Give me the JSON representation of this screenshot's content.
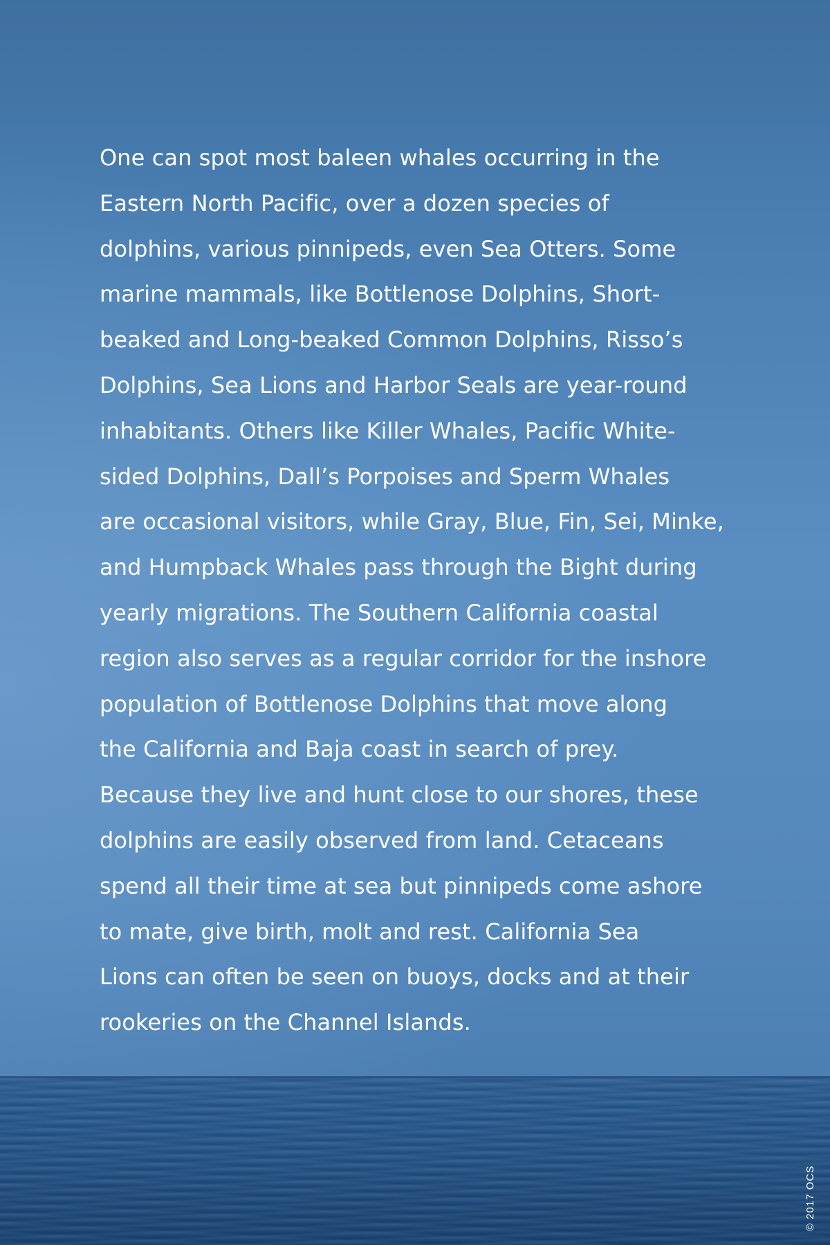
{
  "paragraph": {
    "lines": [
      "One can spot most baleen whales occurring in the",
      "Eastern North Pacific, over a dozen species of",
      "dolphins, various pinnipeds, even Sea Otters. Some",
      "marine mammals, like Bottlenose Dolphins, Short-",
      "beaked and Long-beaked Common Dolphins, Risso’s",
      "Dolphins, Sea Lions and Harbor Seals are year-round",
      "inhabitants. Others like Killer Whales, Pacific White-",
      "sided Dolphins, Dall’s Porpoises and Sperm Whales",
      "are occasional visitors, while Gray, Blue, Fin, Sei, Minke,",
      "and Humpback Whales pass through the Bight during",
      "yearly migrations. The Southern California coastal",
      "region also serves as a regular corridor for the inshore",
      "population of Bottlenose Dolphins that move along",
      "the California and Baja coast in search of prey.",
      "Because they live and hunt close to our shores, these",
      "dolphins are easily observed from land. Cetaceans",
      "spend all their time at sea but pinnipeds come ashore",
      "to mate, give birth, molt and rest. California Sea",
      "Lions can often be seen on buoys, docks and at their",
      "rookeries on the Channel Islands."
    ]
  },
  "copyright": "© 2017 OCS",
  "colors": {
    "sky": "#5a8ec2",
    "sea": "#265587",
    "text": "#ffffff"
  }
}
